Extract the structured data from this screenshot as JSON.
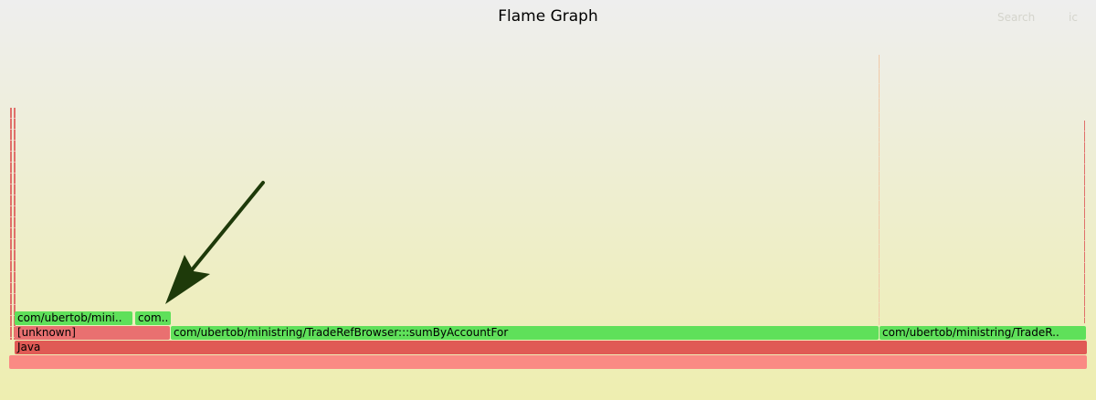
{
  "title": "Flame Graph",
  "header": {
    "search_label": "Search",
    "ic_label": "ic"
  },
  "colors": {
    "root": "#fa8a84",
    "java": "#e05a55",
    "unknown": "#e97070",
    "green": "#5fe05a",
    "arrow": "#1e3a0a",
    "thin_red": "#e0706a"
  },
  "frames": {
    "root": "",
    "java": "Java",
    "unknown": "[unknown]",
    "sum_by_account": "com/ubertob/ministring/TradeRefBrowser:::sumByAccountFor",
    "trade_r": "com/ubertob/ministring/TradeR..",
    "mini_left": "com/ubertob/mini..",
    "com_short": "com.."
  }
}
